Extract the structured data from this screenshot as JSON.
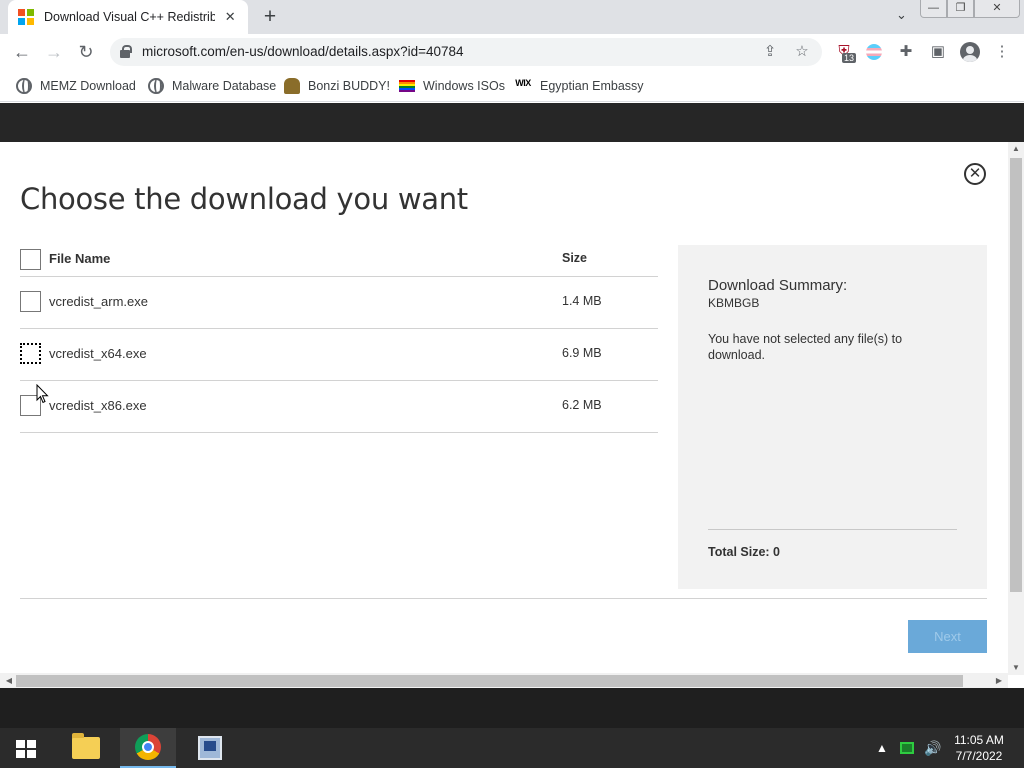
{
  "browser": {
    "tab_title": "Download Visual C++ Redistribu",
    "url": "microsoft.com/en-us/download/details.aspx?id=40784",
    "extension_badge": "13",
    "bookmarks": [
      {
        "label": "MEMZ Download",
        "icon": "globe-icon"
      },
      {
        "label": "Malware Database",
        "icon": "globe-icon"
      },
      {
        "label": "Bonzi BUDDY!",
        "icon": "bonzi-icon"
      },
      {
        "label": "Windows ISOs",
        "icon": "rainbow-flag-icon"
      },
      {
        "label": "Egyptian Embassy",
        "icon": "wix-icon"
      }
    ]
  },
  "modal": {
    "title": "Choose the download you want",
    "table": {
      "headers": {
        "name": "File Name",
        "size": "Size"
      },
      "rows": [
        {
          "name": "vcredist_arm.exe",
          "size": "1.4 MB"
        },
        {
          "name": "vcredist_x64.exe",
          "size": "6.9 MB"
        },
        {
          "name": "vcredist_x86.exe",
          "size": "6.2 MB"
        }
      ]
    },
    "summary": {
      "title": "Download Summary:",
      "subtitle": "KBMBGB",
      "message": "You have not selected any file(s) to download.",
      "total": "Total Size: 0"
    },
    "next_label": "Next"
  },
  "taskbar": {
    "time": "11:05 AM",
    "date": "7/7/2022"
  },
  "colors": {
    "next_button": "#6aa9d9",
    "summary_bg": "#f2f2f2",
    "header_band": "#262626"
  }
}
